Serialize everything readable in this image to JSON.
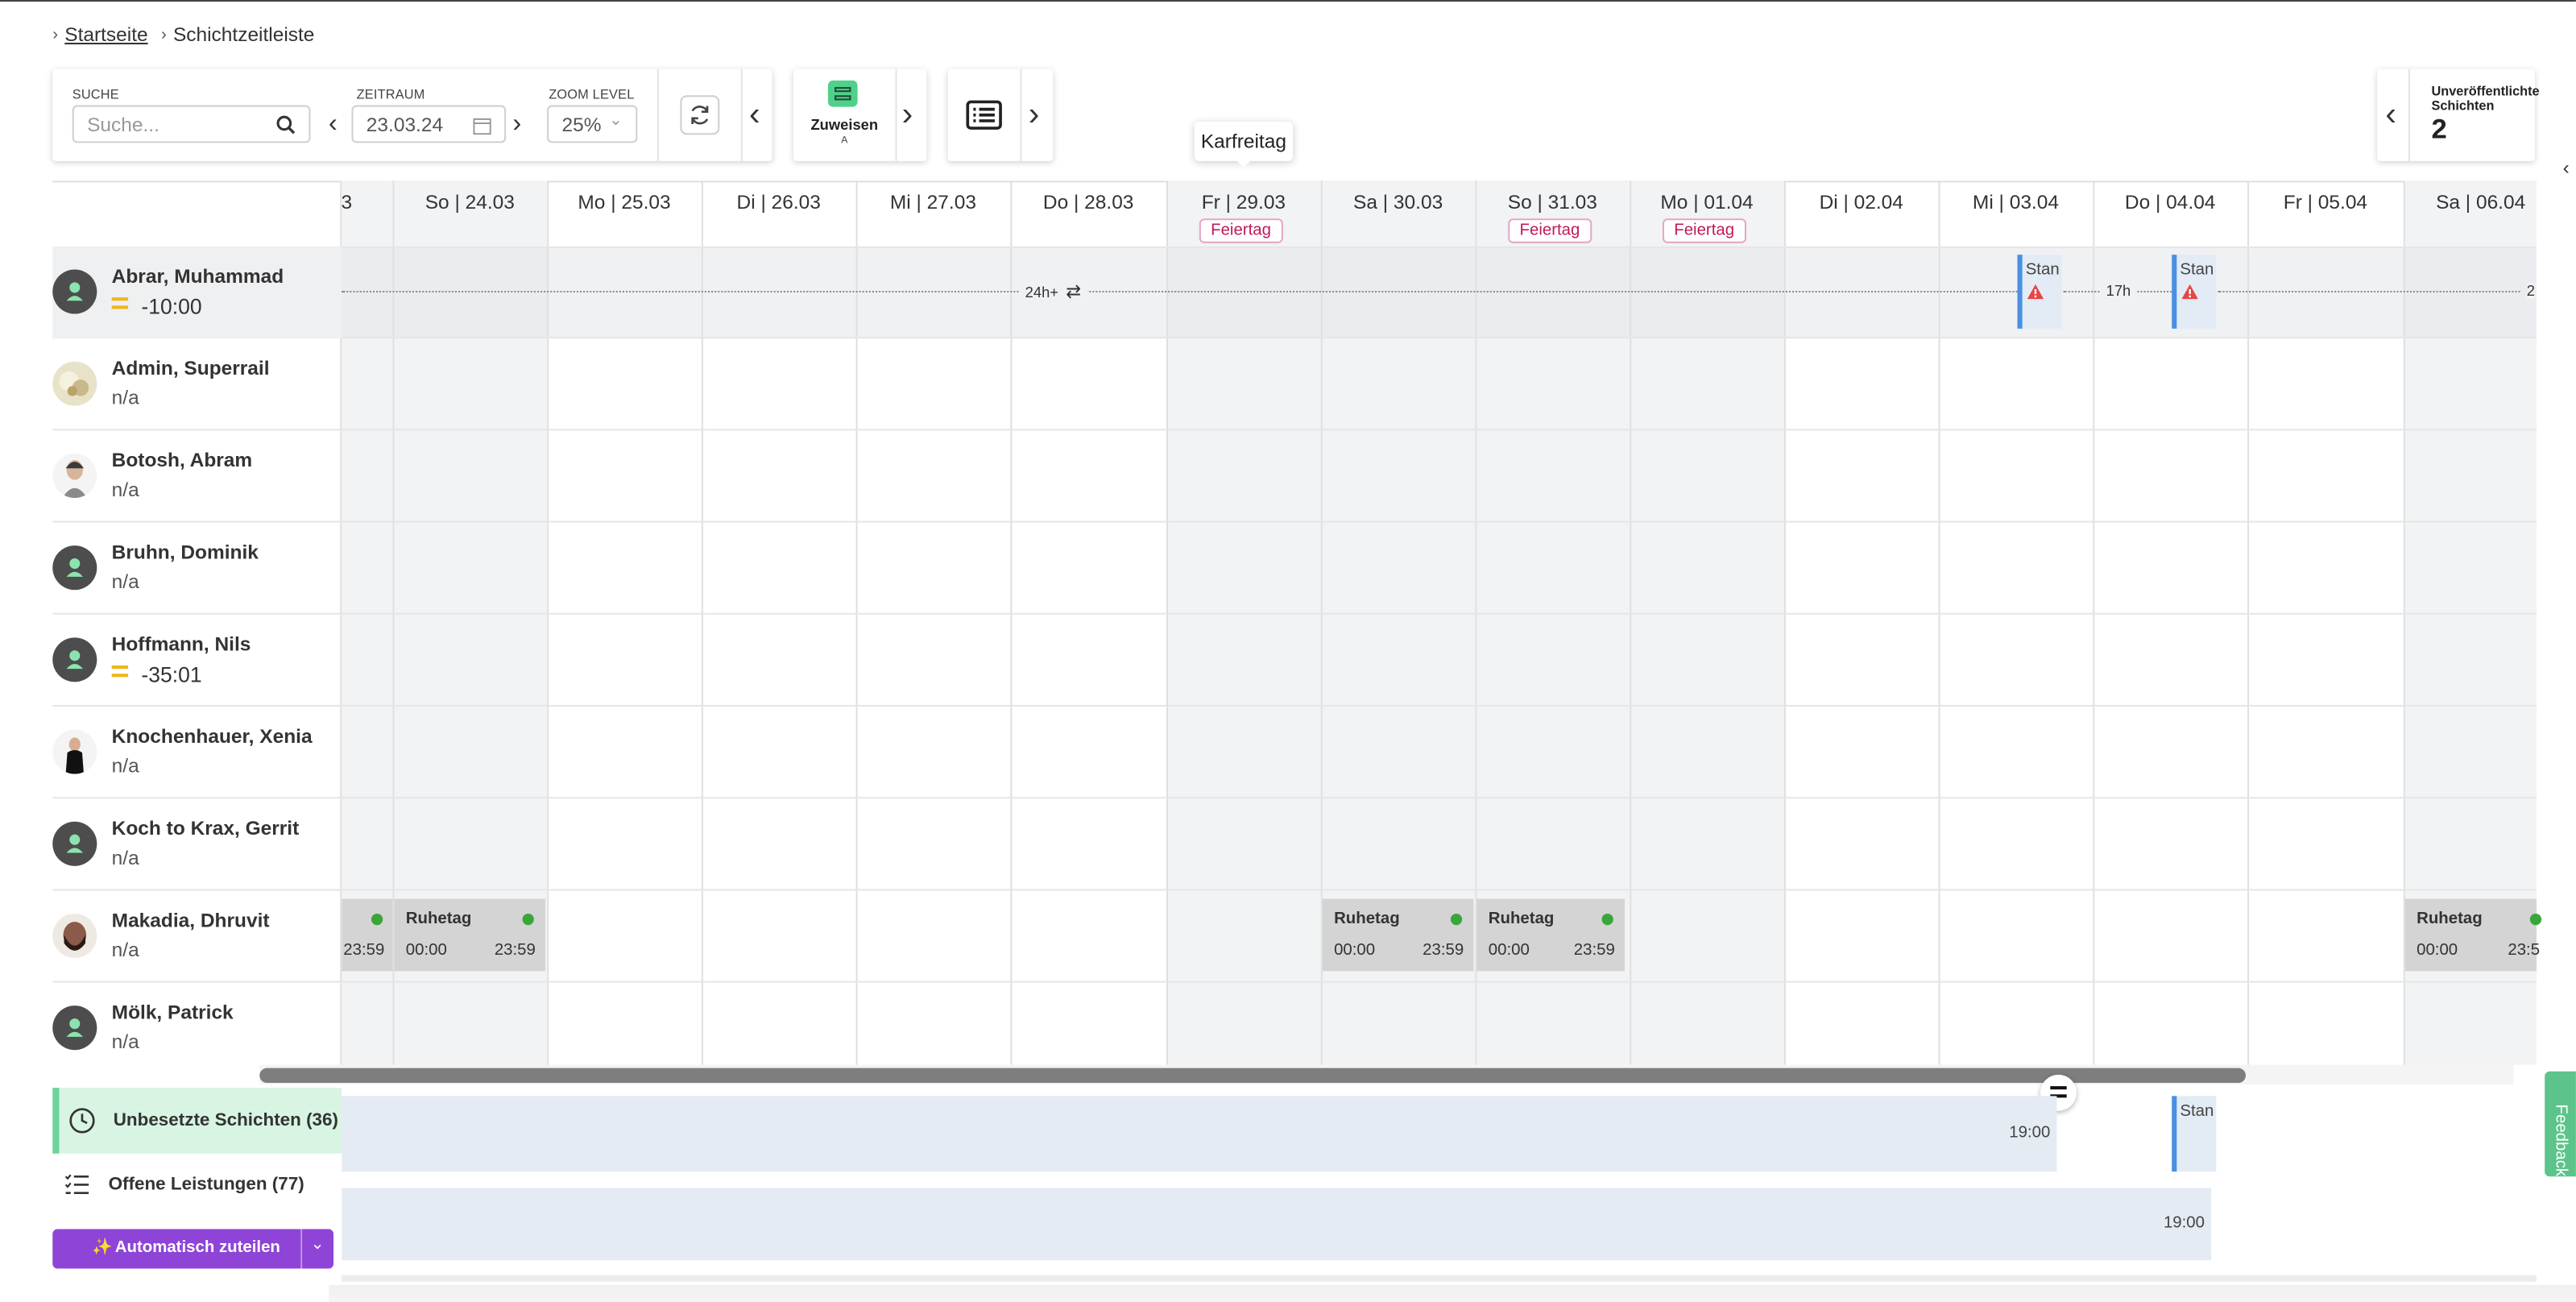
{
  "breadcrumb": {
    "home": "Startseite",
    "current": "Schichtzeitleiste"
  },
  "toolbar": {
    "search_label": "SUCHE",
    "search_placeholder": "Suche...",
    "range_label": "ZEITRAUM",
    "range_value": "23.03.24",
    "zoom_label": "ZOOM LEVEL",
    "zoom_value": "25%",
    "assign_label": "Zuweisen",
    "assign_sub": "A",
    "unpublished_label_1": "Unveröffentlichte",
    "unpublished_label_2": "Schichten",
    "unpublished_count": "2"
  },
  "tooltip": "Karfreitag",
  "days": [
    "3",
    "So | 24.03",
    "Mo | 25.03",
    "Di | 26.03",
    "Mi | 27.03",
    "Do | 28.03",
    "Fr | 29.03",
    "Sa | 30.03",
    "So | 31.03",
    "Mo | 01.04",
    "Di | 02.04",
    "Mi | 03.04",
    "Do | 04.04",
    "Fr | 05.04",
    "Sa | 06.04"
  ],
  "holiday_label": "Feiertag",
  "employees": [
    {
      "name": "Abrar, Muhammad",
      "sub": "-10:00"
    },
    {
      "name": "Admin, Superrail",
      "sub": "n/a"
    },
    {
      "name": "Botosh, Abram",
      "sub": "n/a"
    },
    {
      "name": "Bruhn, Dominik",
      "sub": "n/a"
    },
    {
      "name": "Hoffmann, Nils",
      "sub": "-35:01"
    },
    {
      "name": "Knochenhauer, Xenia",
      "sub": "n/a"
    },
    {
      "name": "Koch to Krax, Gerrit",
      "sub": "n/a"
    },
    {
      "name": "Makadia, Dhruvit",
      "sub": "n/a"
    },
    {
      "name": "Mölk, Patrick",
      "sub": "n/a"
    }
  ],
  "timeline": {
    "gap_label_1": "24h+",
    "gap_label_2": "17h",
    "gap_label_3": "2",
    "stan_label": "Stan",
    "ruhetag_label": "Ruhetag",
    "rest_start": "00:00",
    "rest_end": "23:59",
    "rest_end_partial": "23:59",
    "rest_end_cut": "23:5"
  },
  "bottom": {
    "unbesetzt": "Unbesetzte Schichten (36)",
    "offene": "Offene Leistungen (77)",
    "auto": "Automatisch zuteilen",
    "time1": "19:00",
    "time2": "19:00"
  },
  "feedback_label": "Feedback"
}
